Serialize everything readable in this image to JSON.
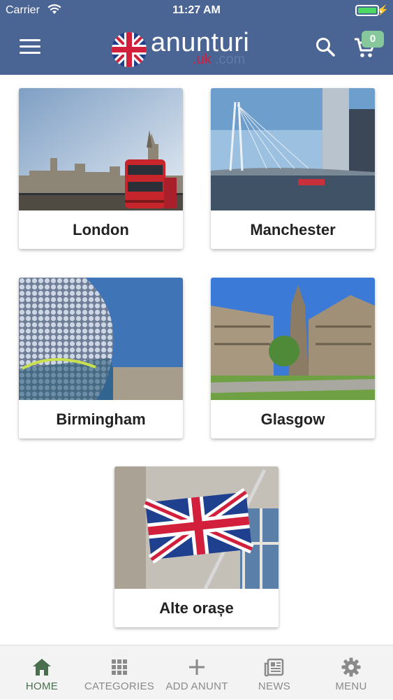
{
  "status_bar": {
    "carrier": "Carrier",
    "time": "11:27 AM",
    "battery_color": "#4cd964"
  },
  "header": {
    "background": "#4a6494",
    "menu_icon": "hamburger-icon",
    "logo_text": "anunturi",
    "logo_sub_red": ".uk",
    "logo_sub_blue": ".com",
    "search_icon": "search-icon",
    "cart_icon": "cart-icon",
    "cart_count": "0",
    "cart_badge_color": "#86c79b"
  },
  "cities": [
    {
      "name": "London"
    },
    {
      "name": "Manchester"
    },
    {
      "name": "Birmingham"
    },
    {
      "name": "Glasgow"
    },
    {
      "name": "Alte orașe"
    }
  ],
  "bottom_nav": [
    {
      "label": "HOME",
      "icon": "home-icon",
      "active": true
    },
    {
      "label": "CATEGORIES",
      "icon": "grid-icon",
      "active": false
    },
    {
      "label": "ADD ANUNT",
      "icon": "plus-icon",
      "active": false
    },
    {
      "label": "NEWS",
      "icon": "newspaper-icon",
      "active": false
    },
    {
      "label": "MENU",
      "icon": "gear-icon",
      "active": false
    }
  ],
  "colors": {
    "active_nav": "#4a6f4e",
    "inactive_nav": "#8a8a8a"
  }
}
